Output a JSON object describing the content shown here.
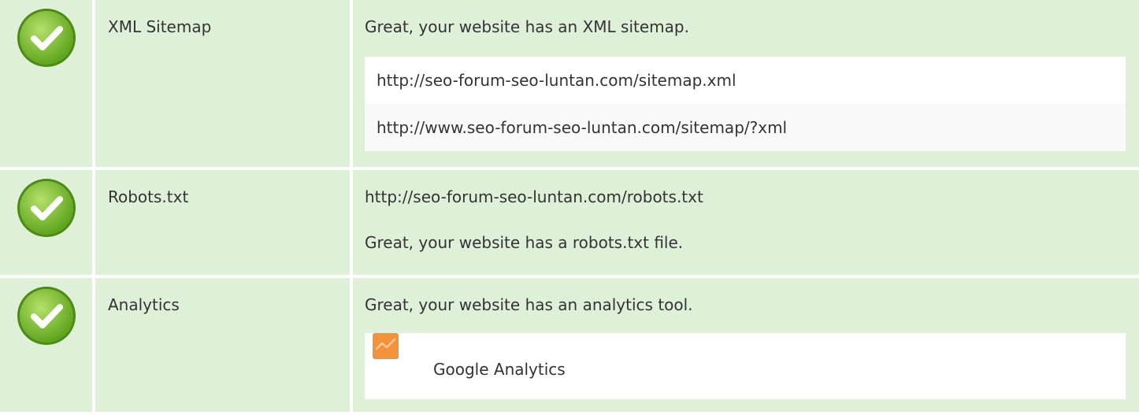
{
  "colors": {
    "row_bg": "#dff0d8",
    "check_green": "#7fbf2a",
    "ga_orange": "#f4923a"
  },
  "rows": [
    {
      "icon": "check-circle-icon",
      "name": "XML Sitemap",
      "message": "Great, your website has an XML sitemap.",
      "items": [
        "http://seo-forum-seo-luntan.com/sitemap.xml",
        "http://www.seo-forum-seo-luntan.com/sitemap/?xml"
      ]
    },
    {
      "icon": "check-circle-icon",
      "name": "Robots.txt",
      "url": "http://seo-forum-seo-luntan.com/robots.txt",
      "message": "Great, your website has a robots.txt file."
    },
    {
      "icon": "check-circle-icon",
      "name": "Analytics",
      "message": "Great, your website has an analytics tool.",
      "tool": {
        "icon": "google-analytics-icon",
        "label": "Google Analytics"
      }
    }
  ]
}
